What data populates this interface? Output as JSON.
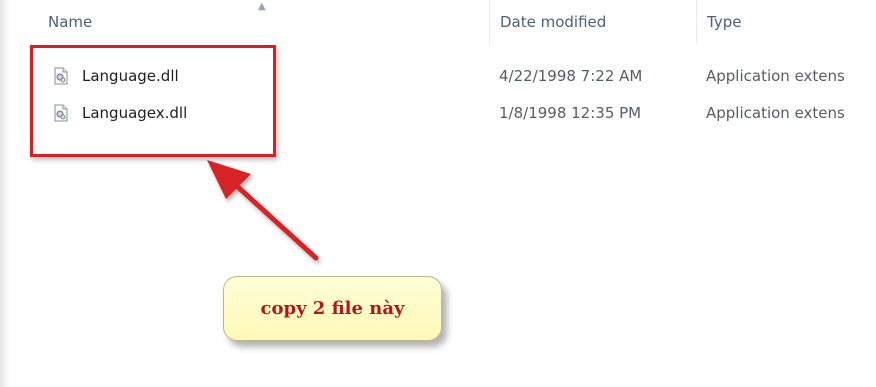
{
  "columns": {
    "name": "Name",
    "date": "Date modified",
    "type": "Type"
  },
  "files": [
    {
      "name": "Language.dll",
      "date": "4/22/1998 7:22 AM",
      "type": "Application extens",
      "icon": "dll-file-icon"
    },
    {
      "name": "Languagex.dll",
      "date": "1/8/1998 12:35 PM",
      "type": "Application extens",
      "icon": "dll-file-icon"
    }
  ],
  "annotation": {
    "callout_text": "copy 2 file này",
    "highlight_color": "#d72026",
    "callout_bg": "#fffbc8",
    "callout_text_color": "#b4161b"
  }
}
